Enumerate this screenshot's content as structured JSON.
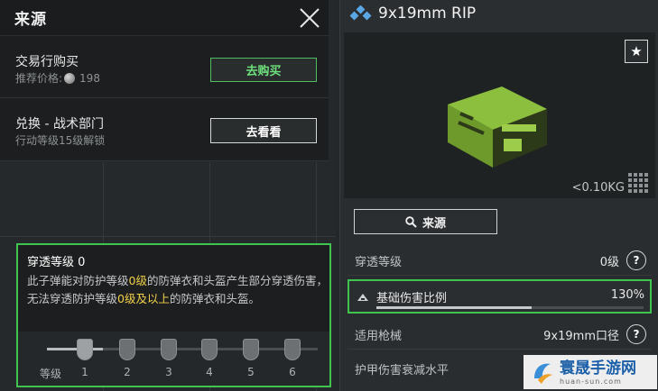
{
  "source_panel": {
    "title": "来源",
    "rows": [
      {
        "title": "交易行购买",
        "sub_prefix": "推荐价格:",
        "price": "198",
        "button": "去购买"
      },
      {
        "title": "兑换 - 战术部门",
        "sub": "行动等级15级解锁",
        "button": "去看看"
      }
    ]
  },
  "penetration_info": {
    "title": "穿透等级 0",
    "desc_1": "此子弹能对防护等级",
    "desc_hl_1": "0级",
    "desc_2": "的防弹衣和头盔产生部分穿透伤害，无法穿透防护等级",
    "desc_hl_2": "0级及以上",
    "desc_3": "的防弹衣和头盔。",
    "scale_word": "等级",
    "levels": [
      "1",
      "2",
      "3",
      "4",
      "5",
      "6"
    ],
    "current_level": 0
  },
  "item": {
    "name": "9x19mm RIP",
    "weight": "<0.10KG",
    "source_button": "来源",
    "stats": [
      {
        "label": "穿透等级",
        "value": "0级"
      },
      {
        "label": "基础伤害比例",
        "value": "130%",
        "fraction": 0.58
      },
      {
        "label": "适用枪械",
        "value": "9x19mm口径"
      },
      {
        "label": "护甲伤害衰减水平",
        "value": ""
      }
    ]
  },
  "watermark": {
    "title": "寰晟手游网",
    "url": "huan-sun.com"
  },
  "colors": {
    "accent_green": "#3ec44f",
    "highlight_yellow": "#f1d14b"
  }
}
